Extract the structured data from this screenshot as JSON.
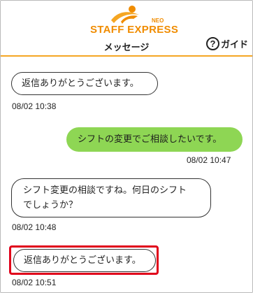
{
  "header": {
    "logo_main": "STAFF EXPRESS",
    "logo_sub": "NEO",
    "title": "メッセージ",
    "guide_icon": "?",
    "guide_label": "ガイド"
  },
  "messages": [
    {
      "direction": "received",
      "text": "返信ありがとうございます。",
      "time": "08/02 10:38"
    },
    {
      "direction": "sent",
      "text": "シフトの変更でご相談したいです。",
      "time": "08/02 10:47"
    },
    {
      "direction": "received",
      "text_line1": "シフト変更の相談ですね。何日のシフト",
      "text_line2": "でしょうか？",
      "time": "08/02 10:48"
    },
    {
      "direction": "received",
      "text": "返信ありがとうございます。",
      "time": "08/02 10:51",
      "highlighted": true
    }
  ],
  "colors": {
    "accent": "#f5a623",
    "logo": "#f08c00",
    "sent_bubble": "#8ed654",
    "highlight": "#e0001a"
  }
}
